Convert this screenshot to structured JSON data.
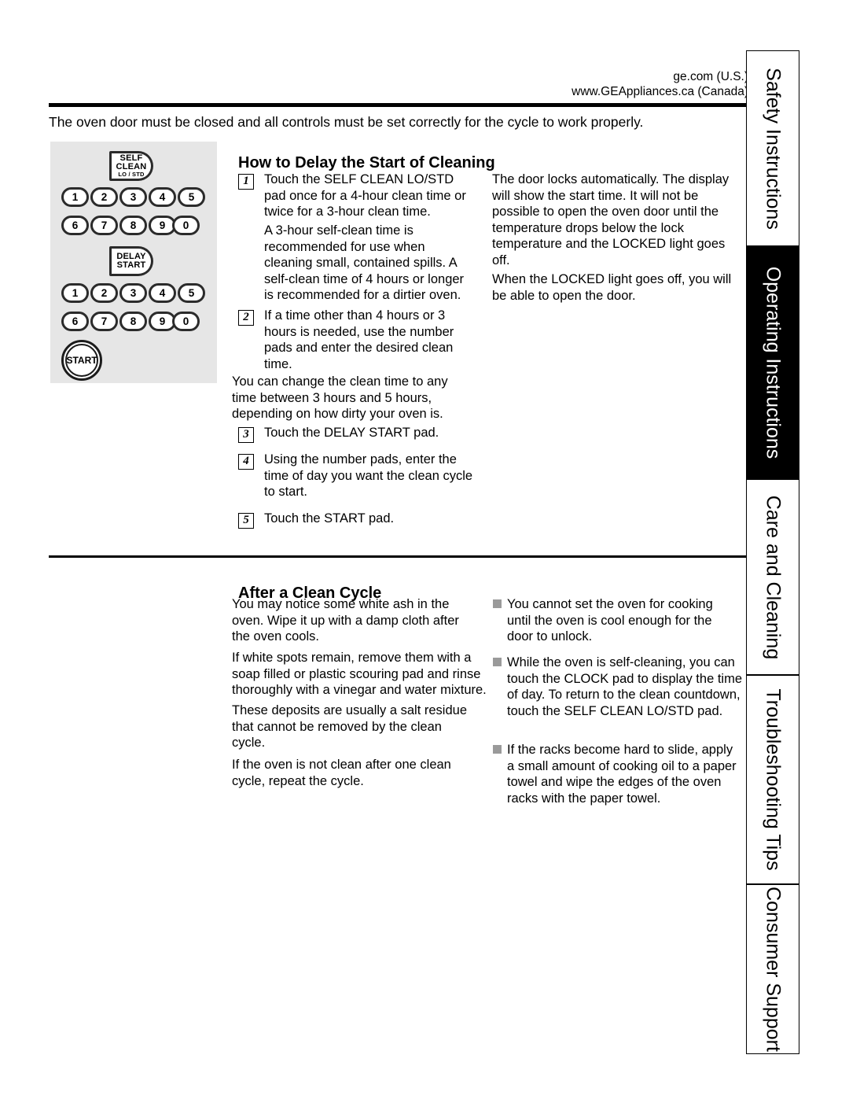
{
  "header": {
    "url_us": "ge.com (U.S.)",
    "url_ca": "www.GEAppliances.ca (Canada)",
    "intro": "The oven door must be closed and all controls must be set correctly for the cycle to work properly."
  },
  "control_panel": {
    "self_clean_key": {
      "line1": "SELF",
      "line2": "CLEAN",
      "line3": "LO / STD"
    },
    "delay_start_key": {
      "line1": "DELAY",
      "line2": "START",
      "line3": ""
    },
    "start_key": "START",
    "numpad_row_a": [
      "1",
      "2",
      "3",
      "4",
      "5"
    ],
    "numpad_row_b": [
      "6",
      "7",
      "8",
      "9",
      "0"
    ]
  },
  "delay_section": {
    "title": "How to Delay the Start of Cleaning",
    "steps": [
      {
        "num": "1",
        "text": "Touch the SELF CLEAN LO/STD pad once for a 4-hour clean time or twice for a 3-hour clean time."
      },
      {
        "num": "2",
        "text": "If a time other than 4 hours or 3 hours is needed, use the number pads and enter the desired clean time."
      },
      {
        "num": "3",
        "text": "Touch the DELAY START pad."
      },
      {
        "num": "4",
        "text": "Using the number pads, enter the time of day you want the clean cycle to start."
      },
      {
        "num": "5",
        "text": "Touch the START pad."
      }
    ],
    "note_after_step1": "A 3-hour self-clean time is recommended for use when cleaning small, contained spills. A self-clean time of 4 hours or longer is recommended for a dirtier oven.",
    "note_after_step2": "You can change the clean time to any time between 3 hours and 5 hours, depending on how dirty your oven is.",
    "right_col": [
      "The door locks automatically. The display will show the start time. It will not be possible to open the oven door until the temperature drops below the lock temperature and the LOCKED light goes off.",
      "When the LOCKED light goes off, you will be able to open the door."
    ]
  },
  "after_clean_section": {
    "title": "After a Clean Cycle",
    "left_paragraphs": [
      "You may notice some white ash in the oven. Wipe it up with a damp cloth after the oven cools.",
      "If white spots remain, remove them with a soap filled or plastic scouring pad and rinse thoroughly with a vinegar and water mixture.",
      "These deposits are usually a salt residue that cannot be removed by the clean cycle.",
      "If the oven is not clean after one clean cycle, repeat the cycle."
    ],
    "right_bullets": [
      "You cannot set the oven for cooking until the oven is cool enough for the door to unlock.",
      "While the oven is self-cleaning, you can touch the CLOCK pad to display the time of day. To return to the clean countdown, touch the SELF CLEAN LO/STD pad.",
      "If the racks become hard to slide, apply a small amount of cooking oil to a paper towel and wipe the edges of the oven racks with the paper towel."
    ]
  },
  "sidebar": {
    "tabs": [
      {
        "label": "Safety Instructions",
        "active": false
      },
      {
        "label": "Operating Instructions",
        "active": true
      },
      {
        "label": "Care and Cleaning",
        "active": false
      },
      {
        "label": "Troubleshooting Tips",
        "active": false
      },
      {
        "label": "Consumer Support",
        "active": false
      }
    ]
  }
}
